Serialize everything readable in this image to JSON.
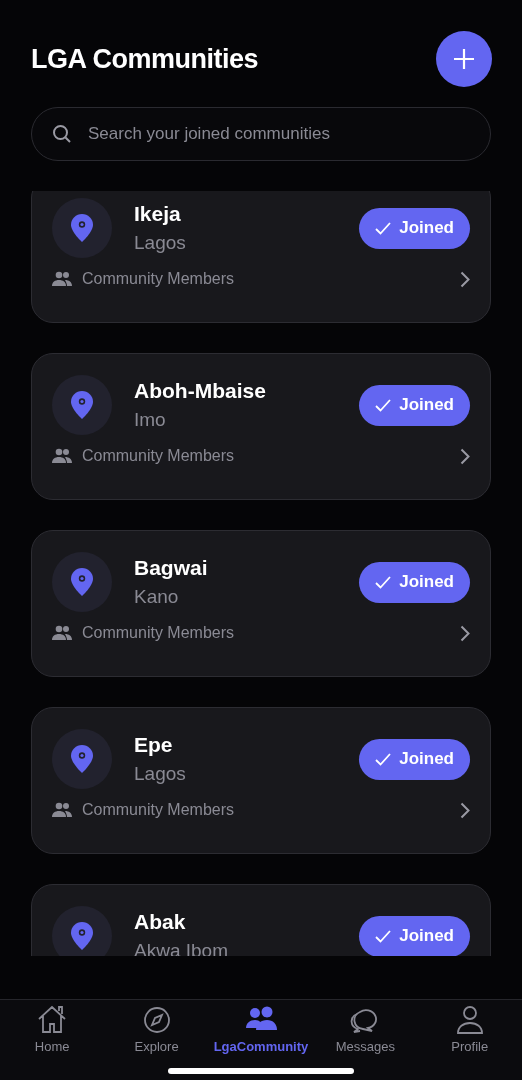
{
  "header": {
    "title": "LGA Communities"
  },
  "search": {
    "placeholder": "Search your joined communities"
  },
  "communities": [
    {
      "name": "Ikeja",
      "state": "Lagos",
      "joined": true,
      "button": "Joined",
      "members_label": "Community Members"
    },
    {
      "name": "Aboh-Mbaise",
      "state": "Imo",
      "joined": true,
      "button": "Joined",
      "members_label": "Community Members"
    },
    {
      "name": "Bagwai",
      "state": "Kano",
      "joined": true,
      "button": "Joined",
      "members_label": "Community Members"
    },
    {
      "name": "Epe",
      "state": "Lagos",
      "joined": true,
      "button": "Joined",
      "members_label": "Community Members"
    },
    {
      "name": "Abak",
      "state": "Akwa Ibom",
      "joined": true,
      "button": "Joined"
    }
  ],
  "nav": [
    {
      "label": "Home",
      "kind": "home",
      "selected": false
    },
    {
      "label": "Explore",
      "kind": "explore",
      "selected": false
    },
    {
      "label": "LgaCommunity",
      "kind": "community",
      "selected": true
    },
    {
      "label": "Messages",
      "kind": "messages",
      "selected": false
    },
    {
      "label": "Profile",
      "kind": "profile",
      "selected": false
    }
  ]
}
